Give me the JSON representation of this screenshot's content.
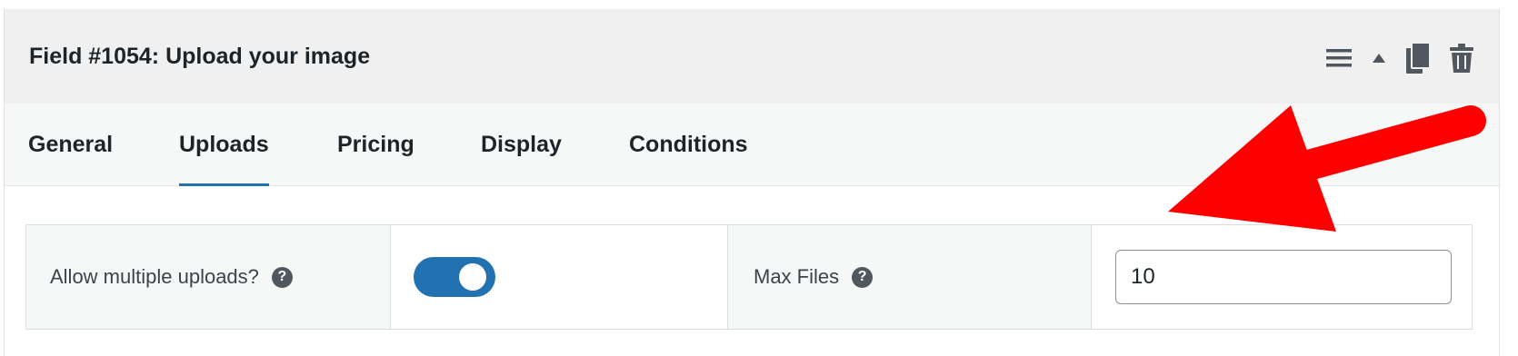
{
  "field": {
    "title": "Field #1054: Upload your image"
  },
  "header_actions": [
    {
      "icon": "hamburger-menu-icon"
    },
    {
      "icon": "caret-up-icon"
    },
    {
      "icon": "duplicate-icon"
    },
    {
      "icon": "trash-icon"
    }
  ],
  "tabs": [
    {
      "label": "General",
      "active": false
    },
    {
      "label": "Uploads",
      "active": true
    },
    {
      "label": "Pricing",
      "active": false
    },
    {
      "label": "Display",
      "active": false
    },
    {
      "label": "Conditions",
      "active": false
    }
  ],
  "options": {
    "allow_multiple": {
      "label": "Allow multiple uploads?",
      "help": "?",
      "enabled": true
    },
    "max_files": {
      "label": "Max Files",
      "help": "?",
      "value": "10"
    }
  },
  "annotation": {
    "color": "#ff0000",
    "icon": "red-arrow"
  },
  "colors": {
    "accent": "#2271b1",
    "header_bg": "#f0f0f1",
    "tabs_bg": "#f6f7f7"
  }
}
